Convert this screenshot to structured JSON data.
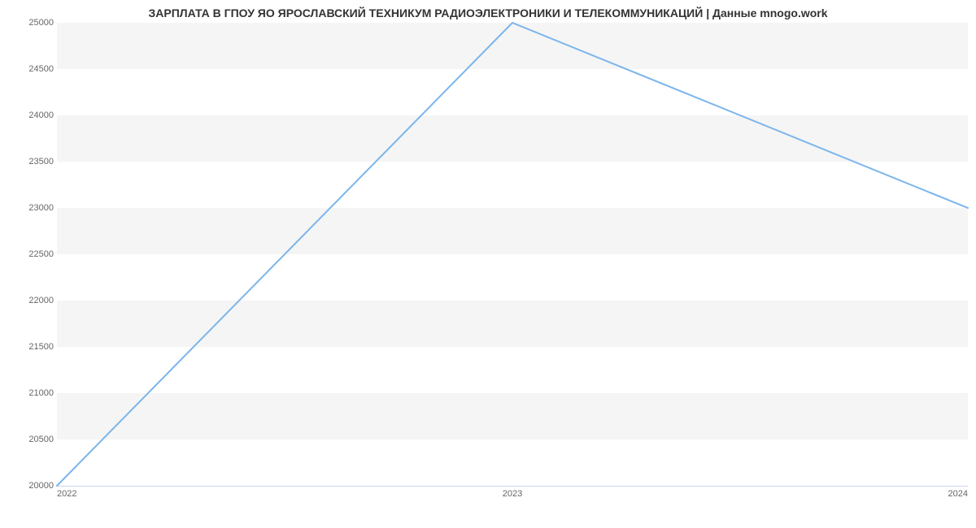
{
  "chart_data": {
    "type": "line",
    "title": "ЗАРПЛАТА В ГПОУ ЯО ЯРОСЛАВСКИЙ ТЕХНИКУМ РАДИОЭЛЕКТРОНИКИ И ТЕЛЕКОММУНИКАЦИЙ | Данные mnogo.work",
    "x": [
      "2022",
      "2023",
      "2024"
    ],
    "values": [
      20000,
      25000,
      23000
    ],
    "xlabel": "",
    "ylabel": "",
    "ylim": [
      20000,
      25000
    ],
    "yticks": [
      20000,
      20500,
      21000,
      21500,
      22000,
      22500,
      23000,
      23500,
      24000,
      24500,
      25000
    ],
    "line_color": "#7cb5ec",
    "band_color": "#f5f5f5"
  }
}
